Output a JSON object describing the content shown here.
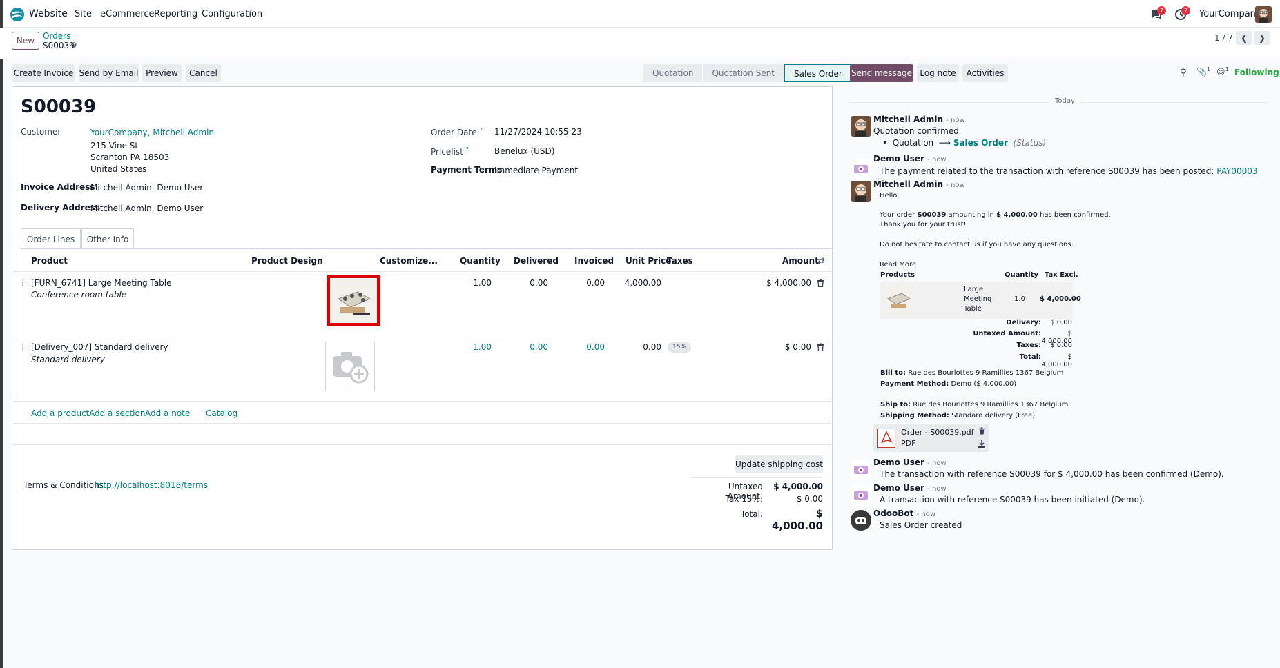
{
  "topbar": {
    "app_name": "Website",
    "menu": [
      "Site",
      "eCommerce",
      "Reporting",
      "Configuration"
    ],
    "messages_count": "7",
    "activities_count": "2",
    "company": "YourCompany"
  },
  "control_panel": {
    "new_label": "New",
    "breadcrumb_parent": "Orders",
    "breadcrumb_current": "S00039",
    "pager": "1 / 7"
  },
  "actions": [
    "Create Invoice",
    "Send by Email",
    "Preview",
    "Cancel"
  ],
  "statusbar": {
    "stages": [
      "Quotation",
      "Quotation Sent",
      "Sales Order"
    ],
    "active": "Sales Order"
  },
  "form": {
    "name": "S00039",
    "customer_label": "Customer",
    "customer_name": "YourCompany, Mitchell Admin",
    "customer_address": [
      "215 Vine St",
      "Scranton PA 18503",
      "United States"
    ],
    "invoice_address_label": "Invoice Address",
    "invoice_address": "Mitchell Admin, Demo User",
    "delivery_address_label": "Delivery Address",
    "delivery_address": "Mitchell Admin, Demo User",
    "order_date_label": "Order Date",
    "order_date": "11/27/2024 10:55:23",
    "pricelist_label": "Pricelist",
    "pricelist": "Benelux (USD)",
    "payment_terms_label": "Payment Terms",
    "payment_terms": "Immediate Payment",
    "help_mark": "?"
  },
  "tabs": [
    "Order Lines",
    "Other Info"
  ],
  "table": {
    "headers": [
      "Product",
      "Product Design",
      "Customize...",
      "Quantity",
      "Delivered",
      "Invoiced",
      "Unit Price",
      "Taxes",
      "Amount"
    ],
    "rows": [
      {
        "product": "[FURN_6741] Large Meeting Table",
        "description": "Conference room table",
        "quantity": "1.00",
        "delivered": "0.00",
        "invoiced": "0.00",
        "unit_price": "4,000.00",
        "taxes": "",
        "amount": "$ 4,000.00"
      },
      {
        "product": "[Delivery_007] Standard delivery",
        "description": "Standard delivery",
        "quantity": "1.00",
        "delivered": "0.00",
        "invoiced": "0.00",
        "unit_price": "0.00",
        "taxes": "15%",
        "amount": "$ 0.00"
      }
    ],
    "add_links": [
      "Add a product",
      "Add a section",
      "Add a note",
      "Catalog"
    ]
  },
  "footer": {
    "update_shipping": "Update shipping cost",
    "terms_label": "Terms & Conditions:",
    "terms_link": "http://localhost:8018/terms",
    "untaxed_label": "Untaxed Amount:",
    "untaxed_value": "$ 4,000.00",
    "tax_label": "Tax 15%:",
    "tax_value": "$ 0.00",
    "total_label": "Total:",
    "total_value": "$ 4,000.00"
  },
  "chatter": {
    "send_message": "Send message",
    "log_note": "Log note",
    "activities": "Activities",
    "attachments_count": "1",
    "followers_count": "1",
    "following": "Following",
    "today": "Today",
    "messages": [
      {
        "author": "Mitchell Admin",
        "when": "- now",
        "text": "Quotation confirmed",
        "tracking_from": "Quotation",
        "tracking_to": "Sales Order",
        "tracking_field": "(Status)"
      },
      {
        "author": "Demo User",
        "when": "- now",
        "text": "The payment related to the transaction with reference S00039 has been posted: ",
        "link": "PAY00003"
      },
      {
        "author": "Mitchell Admin",
        "when": "- now",
        "hello": "Hello,",
        "line1_a": "Your order ",
        "line1_b": "S00039",
        "line1_c": " amounting in ",
        "line1_d": "$ 4,000.00",
        "line1_e": " has been confirmed.",
        "line2": "Thank you for your trust!",
        "line3": "Do not hesitate to contact us if you have any questions.",
        "read_more": "Read More",
        "emb_products": "Products",
        "emb_quantity": "Quantity",
        "emb_taxexcl": "Tax Excl.",
        "emb_product_name": [
          "Large",
          "Meeting",
          "Table"
        ],
        "emb_qty": "1.0",
        "emb_amount": "$ 4,000.00",
        "emb_delivery_l": "Delivery:",
        "emb_delivery_v": "$ 0.00",
        "emb_untaxed_l": "Untaxed Amount:",
        "emb_untaxed_v": "$ 4,000.00",
        "emb_taxes_l": "Taxes:",
        "emb_taxes_v": "$ 0.00",
        "emb_total_l": "Total:",
        "emb_total_v": "$ 4,000.00",
        "bill_l": "Bill to:",
        "bill_v": " Rue des Bourlottes 9 Ramillies 1367 Belgium",
        "pay_l": "Payment Method:",
        "pay_v": " Demo ($ 4,000.00)",
        "ship_l": "Ship to:",
        "ship_v": " Rue des Bourlottes 9 Ramillies 1367 Belgium",
        "shipm_l": "Shipping Method:",
        "shipm_v": " Standard delivery (Free)",
        "attachment_name": "Order - S00039.pdf",
        "attachment_type": "PDF"
      },
      {
        "author": "Demo User",
        "when": "- now",
        "text": "The transaction with reference S00039 for $ 4,000.00 has been confirmed (Demo)."
      },
      {
        "author": "Demo User",
        "when": "- now",
        "text": "A transaction with reference S00039 has been initiated (Demo)."
      },
      {
        "author": "OdooBot",
        "when": "- now",
        "text": "Sales Order created"
      }
    ]
  },
  "colors": {
    "primary": "#714b67",
    "link": "#017e84",
    "highlight": "#dc0000",
    "following": "#28a745"
  }
}
